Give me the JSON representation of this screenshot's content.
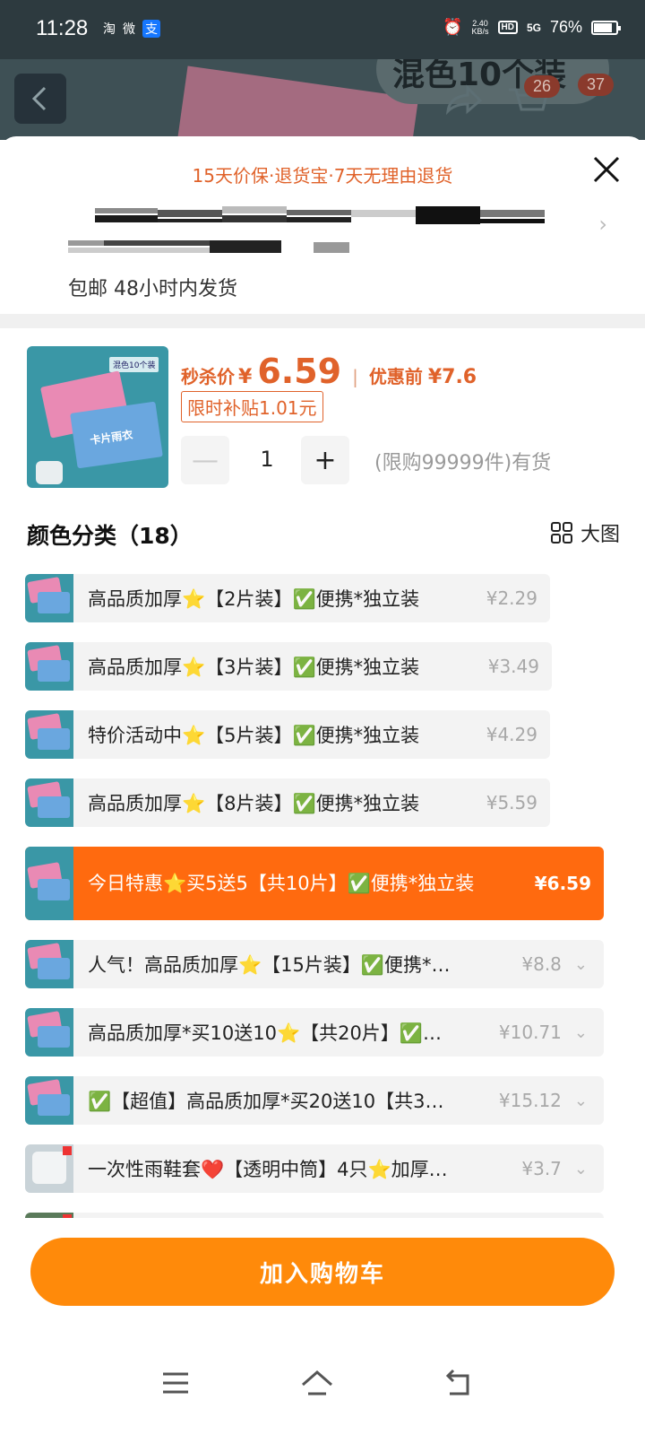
{
  "status_bar": {
    "time": "11:28",
    "app_icons": [
      "淘",
      "微",
      "支"
    ],
    "net_speed_value": "2.40",
    "net_speed_unit": "KB/s",
    "hd": "HD",
    "signal": "5G",
    "battery": "76%"
  },
  "background_page": {
    "banner_text": "混色10个装",
    "cart_badge": "26",
    "msg_badge": "37"
  },
  "sheet": {
    "guarantee": "15天价保·退货宝·7天无理由退货",
    "shipping": "包邮 48小时内发货"
  },
  "product": {
    "thumb_tag": "混色10个装",
    "thumb_card_text": "卡片雨衣",
    "price_label": "秒杀价",
    "currency": "¥",
    "price": "6.59",
    "separator": "|",
    "before_label": "优惠前",
    "before_price": "¥7.6",
    "subsidy": "限时补贴1.01元",
    "quantity": "1",
    "stock": "(限购99999件)有货"
  },
  "stepper": {
    "minus": "—",
    "plus": "+"
  },
  "section": {
    "title": "颜色分类（18）",
    "big_view_label": "大图"
  },
  "options": [
    {
      "label": "高品质加厚⭐【2片装】✅便携*独立装",
      "price": "¥2.29"
    },
    {
      "label": "高品质加厚⭐【3片装】✅便携*独立装",
      "price": "¥3.49"
    },
    {
      "label": "特价活动中⭐【5片装】✅便携*独立装",
      "price": "¥4.29"
    },
    {
      "label": "高品质加厚⭐【8片装】✅便携*独立装",
      "price": "¥5.59"
    },
    {
      "label": "今日特惠⭐买5送5【共10片】✅便携*独立装",
      "price": "¥6.59"
    },
    {
      "label": "人气！高品质加厚⭐【15片装】✅便携*…",
      "price": "¥8.8"
    },
    {
      "label": "高品质加厚*买10送10⭐【共20片】✅…",
      "price": "¥10.71"
    },
    {
      "label": "✅【超值】高品质加厚*买20送10【共3…",
      "price": "¥15.12"
    },
    {
      "label": "一次性雨鞋套❤️【透明中筒】4只⭐加厚…",
      "price": "¥3.7"
    }
  ],
  "add_to_cart": "加入购物车",
  "colors": {
    "accent": "#ff6a0f",
    "button": "#ff8a0a",
    "price_text": "#e0622a"
  }
}
